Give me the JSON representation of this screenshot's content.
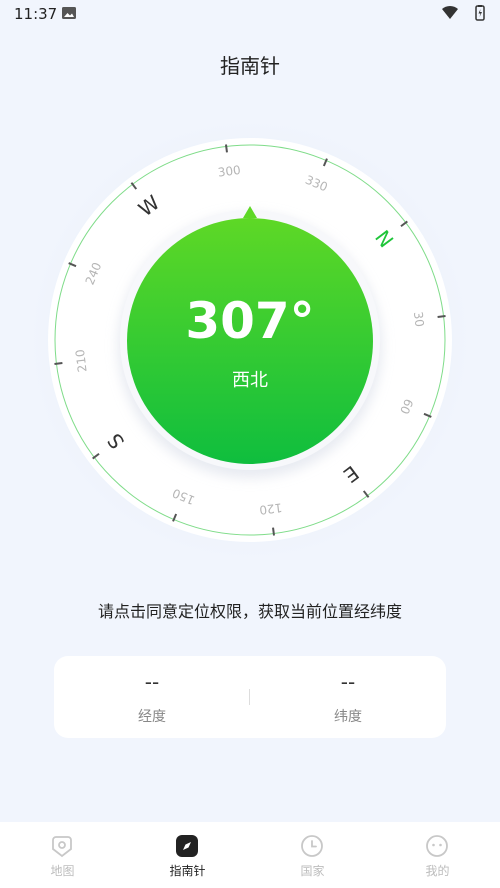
{
  "status": {
    "time": "11:37"
  },
  "header": {
    "title": "指南针"
  },
  "compass": {
    "heading": "307°",
    "direction": "西北",
    "heading_degrees": 307,
    "cardinals": [
      "N",
      "E",
      "S",
      "W"
    ],
    "degree_labels": [
      "30",
      "60",
      "120",
      "150",
      "210",
      "240",
      "300",
      "330"
    ],
    "accent_color": "#1fc53a"
  },
  "hint": "请点击同意定位权限，获取当前位置经纬度",
  "coords": {
    "longitude": {
      "value": "--",
      "label": "经度"
    },
    "latitude": {
      "value": "--",
      "label": "纬度"
    }
  },
  "tabs": [
    {
      "label": "地图",
      "icon": "map-pin-icon"
    },
    {
      "label": "指南针",
      "icon": "compass-icon"
    },
    {
      "label": "国家",
      "icon": "clock-icon"
    },
    {
      "label": "我的",
      "icon": "face-icon"
    }
  ]
}
